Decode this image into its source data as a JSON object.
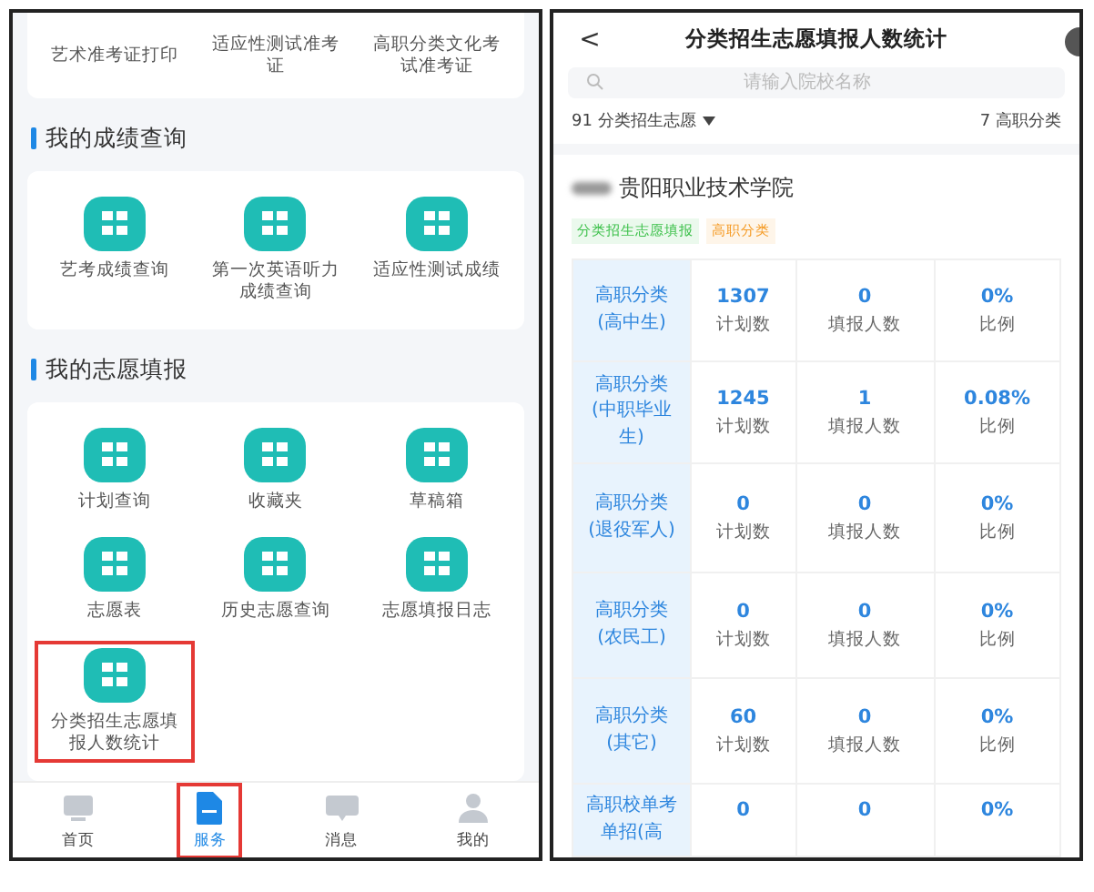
{
  "services_screen": {
    "top_items": [
      {
        "label": "艺术准考证打印"
      },
      {
        "label": "适应性测试准考证"
      },
      {
        "label": "高职分类文化考试准考证"
      }
    ],
    "sections": [
      {
        "title": "我的成绩查询",
        "items": [
          {
            "label": "艺考成绩查询",
            "highlighted": false
          },
          {
            "label": "第一次英语听力成绩查询",
            "highlighted": false
          },
          {
            "label": "适应性测试成绩",
            "highlighted": false
          }
        ]
      },
      {
        "title": "我的志愿填报",
        "items": [
          {
            "label": "计划查询",
            "highlighted": false
          },
          {
            "label": "收藏夹",
            "highlighted": false
          },
          {
            "label": "草稿箱",
            "highlighted": false
          },
          {
            "label": "志愿表",
            "highlighted": false
          },
          {
            "label": "历史志愿查询",
            "highlighted": false
          },
          {
            "label": "志愿填报日志",
            "highlighted": false
          },
          {
            "label": "分类招生志愿填报人数统计",
            "highlighted": true
          }
        ]
      }
    ],
    "tab_bar": [
      {
        "label": "首页",
        "kind": "home",
        "selected": false,
        "highlighted": false
      },
      {
        "label": "服务",
        "kind": "service",
        "selected": true,
        "highlighted": true
      },
      {
        "label": "消息",
        "kind": "message",
        "selected": false,
        "highlighted": false
      },
      {
        "label": "我的",
        "kind": "profile",
        "selected": false,
        "highlighted": false
      }
    ]
  },
  "stats_screen": {
    "back": "<",
    "title": "分类招生志愿填报人数统计",
    "search": {
      "placeholder": "请输入院校名称"
    },
    "filters": [
      {
        "label": "91 分类招生志愿",
        "dropdown": true
      },
      {
        "label": "7 高职分类",
        "dropdown": false
      }
    ],
    "school": {
      "name": "贵阳职业技术学院",
      "tags": [
        {
          "label": "分类招生志愿填报",
          "color": "#3cc04a"
        },
        {
          "label": "高职分类",
          "color": "#f59a23"
        }
      ]
    },
    "rows": [
      {
        "category": "高职分类(高中生)",
        "plan": "1307",
        "plan_label": "计划数",
        "applicants": "0",
        "applicants_label": "填报人数",
        "ratio": "0%",
        "ratio_label": "比例"
      },
      {
        "category": "高职分类(中职毕业生)",
        "plan": "1245",
        "plan_label": "计划数",
        "applicants": "1",
        "applicants_label": "填报人数",
        "ratio": "0.08%",
        "ratio_label": "比例"
      },
      {
        "category": "高职分类(退役军人)",
        "plan": "0",
        "plan_label": "计划数",
        "applicants": "0",
        "applicants_label": "填报人数",
        "ratio": "0%",
        "ratio_label": "比例"
      },
      {
        "category": "高职分类(农民工)",
        "plan": "0",
        "plan_label": "计划数",
        "applicants": "0",
        "applicants_label": "填报人数",
        "ratio": "0%",
        "ratio_label": "比例"
      },
      {
        "category": "高职分类(其它)",
        "plan": "60",
        "plan_label": "计划数",
        "applicants": "0",
        "applicants_label": "填报人数",
        "ratio": "0%",
        "ratio_label": "比例"
      },
      {
        "category": "高职校单考单招(高",
        "plan": "0",
        "applicants": "0",
        "ratio": "0%"
      }
    ]
  }
}
